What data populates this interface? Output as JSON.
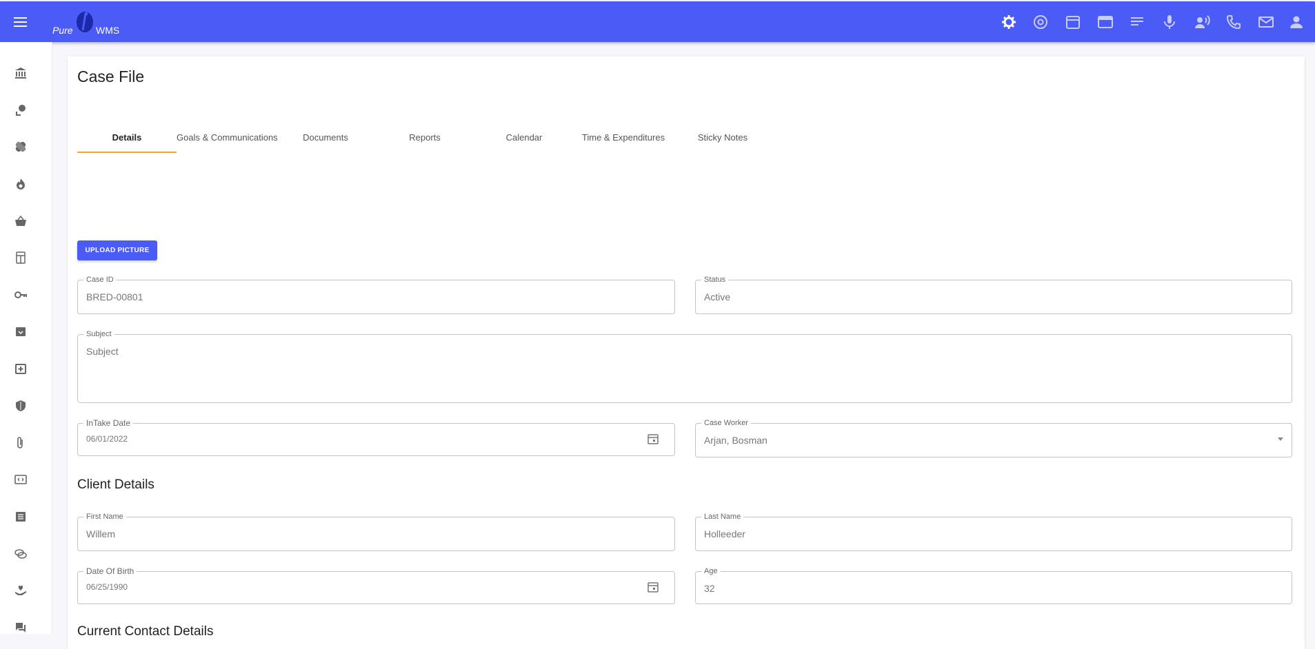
{
  "app": {
    "logo_pure": "Pure",
    "logo_wms": "WMS",
    "brand_color": "#4a5cf5",
    "accent_color": "#f5a623"
  },
  "topbar": {
    "icons": [
      "settings-icon",
      "at-sign-icon",
      "calendar-icon",
      "browser-window-icon",
      "notes-lines-icon",
      "microphone-icon",
      "voice-speaker-icon",
      "phone-icon",
      "mail-icon",
      "account-icon"
    ]
  },
  "sidebar": {
    "icons": [
      "bank-icon",
      "user-location-icon",
      "bandage-icon",
      "fire-icon",
      "basket-icon",
      "calculator-icon",
      "key-icon",
      "archive-icon",
      "medical-box-icon",
      "shield-icon",
      "paperclip-icon",
      "expand-box-icon",
      "list-box-icon",
      "chat-bubbles-icon",
      "hand-heart-icon",
      "forum-icon"
    ]
  },
  "page": {
    "title": "Case File"
  },
  "tabs": [
    {
      "label": "Details",
      "active": true
    },
    {
      "label": "Goals & Communications"
    },
    {
      "label": "Documents"
    },
    {
      "label": "Reports"
    },
    {
      "label": "Calendar"
    },
    {
      "label": "Time & Expenditures"
    },
    {
      "label": "Sticky Notes"
    }
  ],
  "upload": {
    "label": "UPLOAD PICTURE"
  },
  "form": {
    "case_id": {
      "label": "Case ID",
      "value": "BRED-00801"
    },
    "status": {
      "label": "Status",
      "value": "Active"
    },
    "subject": {
      "label": "Subject",
      "placeholder": "Subject"
    },
    "intake_date": {
      "label": "InTake Date",
      "value": "06/01/2022"
    },
    "case_worker": {
      "label": "Case Worker",
      "value": "Arjan, Bosman"
    }
  },
  "client_details": {
    "title": "Client Details",
    "first_name": {
      "label": "First Name",
      "value": "Willem"
    },
    "last_name": {
      "label": "Last Name",
      "value": "Holleeder"
    },
    "dob": {
      "label": "Date Of Birth",
      "value": "06/25/1990"
    },
    "age": {
      "label": "Age",
      "value": "32"
    }
  },
  "contact_details": {
    "title": "Current Contact Details"
  }
}
